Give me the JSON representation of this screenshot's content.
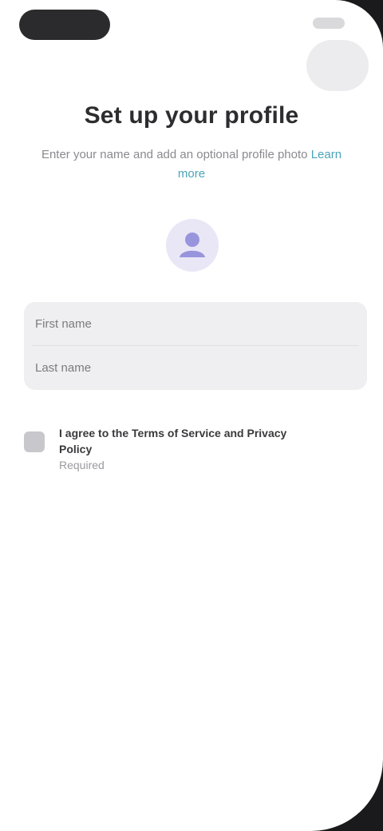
{
  "screen": {
    "title": "Set up your profile",
    "subtitle_text": "Enter your name and add an optional profile photo",
    "subtitle_link": "Learn more"
  },
  "avatar": {
    "icon": "person-icon"
  },
  "form": {
    "first_name_placeholder": "First name",
    "last_name_placeholder": "Last name"
  },
  "consent": {
    "label": "I agree to the Terms of Service and Privacy Policy",
    "sublabel": "Required"
  },
  "colors": {
    "accent": "#4aa3b8",
    "avatar_bg": "#e9e7f6",
    "avatar_fg": "#8a86d8",
    "field_bg": "#efeff1"
  }
}
